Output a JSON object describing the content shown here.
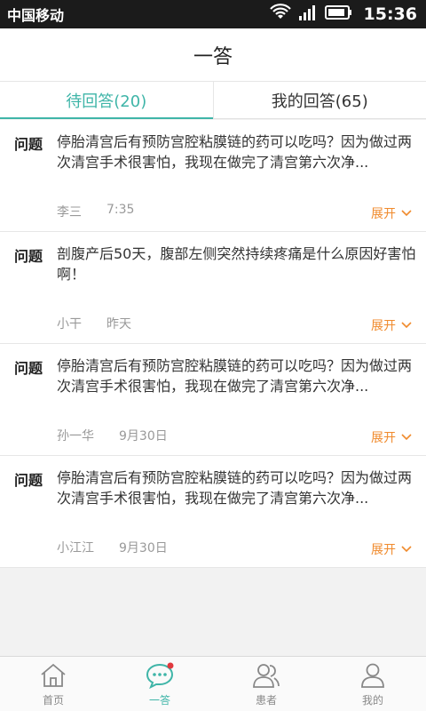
{
  "status_bar": {
    "carrier": "中国移动",
    "time": "15:36"
  },
  "app_bar": {
    "title": "一答"
  },
  "tabs": [
    {
      "label": "待回答(20)",
      "active": true
    },
    {
      "label": "我的回答(65)",
      "active": false
    }
  ],
  "questions": [
    {
      "label": "问题",
      "text": "停胎清宫后有预防宫腔粘膜链的药可以吃吗？因为做过两次清宫手术很害怕，我现在做完了清宫第六次净...",
      "author": "李三",
      "time": "7:35",
      "expand_label": "展开"
    },
    {
      "label": "问题",
      "text": "剖腹产后50天，腹部左侧突然持续疼痛是什么原因好害怕啊！",
      "author": "小干",
      "time": "昨天",
      "expand_label": "展开"
    },
    {
      "label": "问题",
      "text": "停胎清宫后有预防宫腔粘膜链的药可以吃吗？因为做过两次清宫手术很害怕，我现在做完了清宫第六次净...",
      "author": "孙一华",
      "time": "9月30日",
      "expand_label": "展开"
    },
    {
      "label": "问题",
      "text": "停胎清宫后有预防宫腔粘膜链的药可以吃吗？因为做过两次清宫手术很害怕，我现在做完了清宫第六次净...",
      "author": "小江江",
      "time": "9月30日",
      "expand_label": "展开"
    }
  ],
  "bottom_nav": [
    {
      "label": "首页",
      "icon": "home-icon",
      "active": false
    },
    {
      "label": "一答",
      "icon": "chat-icon",
      "active": true
    },
    {
      "label": "患者",
      "icon": "patients-icon",
      "active": false
    },
    {
      "label": "我的",
      "icon": "profile-icon",
      "active": false
    }
  ],
  "colors": {
    "accent": "#3fb5a8",
    "expand": "#f08a2c",
    "badge": "#e0393e"
  }
}
